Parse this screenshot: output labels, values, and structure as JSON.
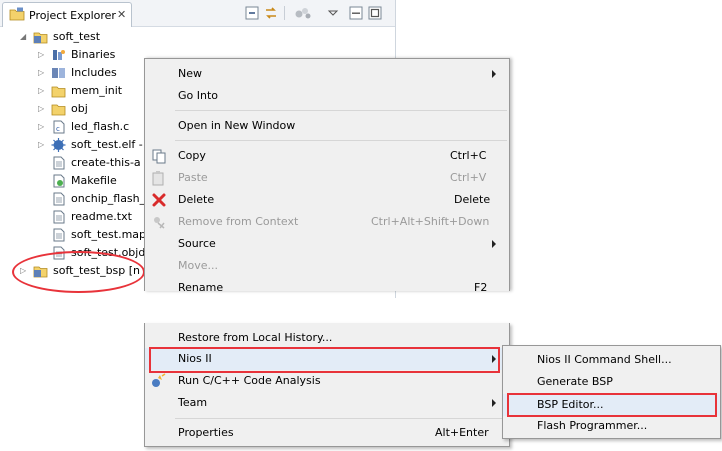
{
  "panel": {
    "tab_title": "Project Explorer",
    "tab_close": "✕"
  },
  "tree": {
    "project": "soft_test",
    "items": [
      {
        "label": "Binaries"
      },
      {
        "label": "Includes"
      },
      {
        "label": "mem_init"
      },
      {
        "label": "obj"
      },
      {
        "label": "led_flash.c"
      },
      {
        "label": "soft_test.elf -"
      },
      {
        "label": "create-this-a"
      },
      {
        "label": "Makefile"
      },
      {
        "label": "onchip_flash_"
      },
      {
        "label": "readme.txt"
      },
      {
        "label": "soft_test.map"
      },
      {
        "label": "soft_test.objd"
      }
    ],
    "bsp_project": "soft_test_bsp [n"
  },
  "context_menu": {
    "items": {
      "new": "New",
      "go_into": "Go Into",
      "open_new_window": "Open in New Window",
      "copy": "Copy",
      "copy_sc": "Ctrl+C",
      "paste": "Paste",
      "paste_sc": "Ctrl+V",
      "delete": "Delete",
      "delete_sc": "Delete",
      "remove_context": "Remove from Context",
      "remove_context_sc": "Ctrl+Alt+Shift+Down",
      "source": "Source",
      "move": "Move...",
      "rename": "Rename",
      "rename_sc": "F2",
      "restore": "Restore from Local History...",
      "nios": "Nios II",
      "run_analysis": "Run C/C++ Code Analysis",
      "team": "Team",
      "properties": "Properties",
      "properties_sc": "Alt+Enter"
    }
  },
  "submenu": {
    "items": {
      "command_shell": "Nios II Command Shell...",
      "generate_bsp": "Generate BSP",
      "bsp_editor": "BSP Editor...",
      "flash_programmer": "Flash Programmer..."
    }
  },
  "colors": {
    "highlight_box": "#e8333a",
    "menu_bg": "#f0f0f0",
    "menu_border": "#979797"
  }
}
